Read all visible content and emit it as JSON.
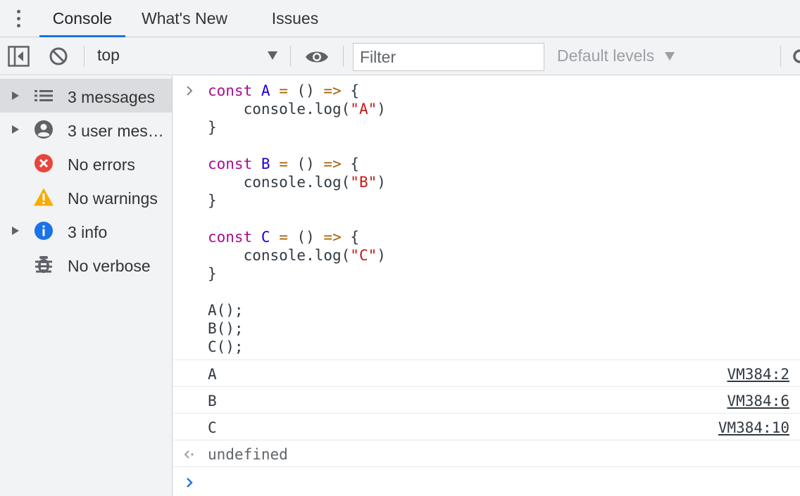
{
  "tabs": [
    {
      "label": "Console",
      "active": true
    },
    {
      "label": "What's New",
      "active": false
    },
    {
      "label": "Issues",
      "active": false
    }
  ],
  "toolbar": {
    "context": "top",
    "filter_placeholder": "Filter",
    "levels_label": "Default levels"
  },
  "sidebar": {
    "items": [
      {
        "label": "3 messages",
        "icon": "list-icon",
        "expandable": true,
        "selected": true
      },
      {
        "label": "3 user mes…",
        "icon": "user-icon",
        "expandable": true,
        "selected": false
      },
      {
        "label": "No errors",
        "icon": "error-icon",
        "expandable": false,
        "selected": false
      },
      {
        "label": "No warnings",
        "icon": "warning-icon",
        "expandable": false,
        "selected": false
      },
      {
        "label": "3 info",
        "icon": "info-icon",
        "expandable": true,
        "selected": false
      },
      {
        "label": "No verbose",
        "icon": "bug-icon",
        "expandable": false,
        "selected": false
      }
    ]
  },
  "console": {
    "code": {
      "const_kw": "const",
      "arrow": "=>",
      "fn_A": "A",
      "fn_B": "B",
      "fn_C": "C",
      "log_call": "console.log(",
      "str_A": "\"A\"",
      "str_B": "\"B\"",
      "str_C": "\"C\"",
      "call_A": "A();",
      "call_B": "B();",
      "call_C": "C();"
    },
    "logs": [
      {
        "text": "A",
        "source": "VM384:2"
      },
      {
        "text": "B",
        "source": "VM384:6"
      },
      {
        "text": "C",
        "source": "VM384:10"
      }
    ],
    "result": "undefined"
  },
  "colors": {
    "accent": "#1a73e8",
    "keyword": "#aa0d91",
    "variable": "#1c00cf",
    "operator": "#a85d00",
    "string": "#c41a16",
    "error": "#e8453c",
    "warning": "#f9ab00",
    "info": "#1a73e8"
  }
}
